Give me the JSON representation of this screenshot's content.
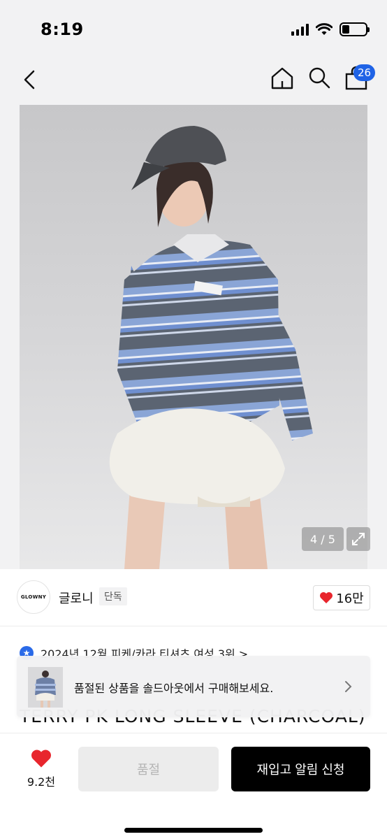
{
  "status_bar": {
    "time": "8:19"
  },
  "nav": {
    "cart_count": "26"
  },
  "image": {
    "counter": "4 / 5"
  },
  "brand": {
    "logo_text": "GLOWNY",
    "name": "글로니",
    "tag": "단독",
    "likes": "16만"
  },
  "ranking": {
    "text": "2024년 12월 피케/카라 티셔츠 여성 3위  >"
  },
  "title_peek": "TERRY PK LONG SLEEVE (CHARCOAL)",
  "banner": {
    "text": "품절된 상품을 솔드아웃에서 구매해보세요."
  },
  "bottom": {
    "wish_count": "9.2천",
    "soldout_label": "품절",
    "restock_label": "재입고 알림 신청"
  },
  "colors": {
    "accent_blue": "#1f63e6",
    "heart_red": "#e8262d",
    "primary_black": "#000000"
  }
}
